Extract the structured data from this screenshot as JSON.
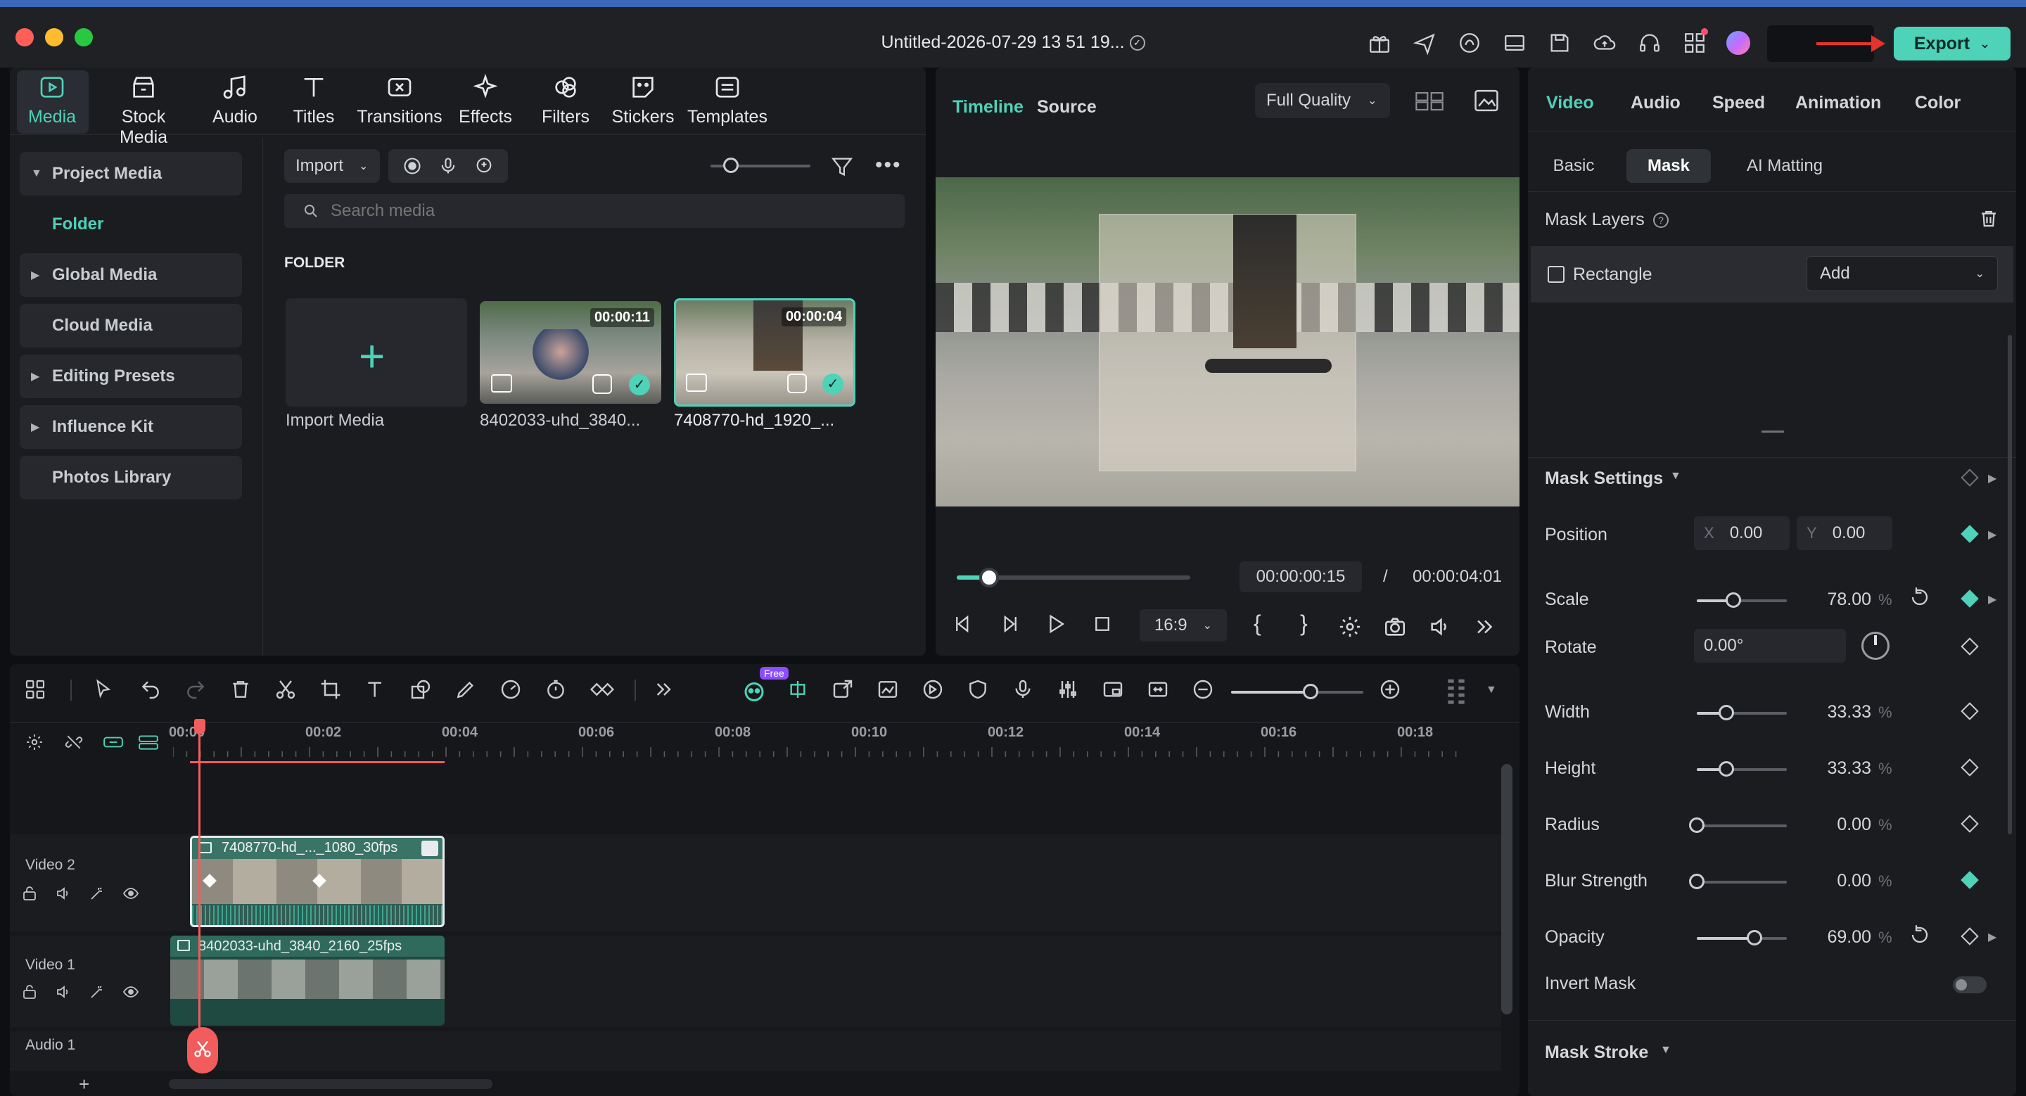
{
  "window": {
    "title": "Untitled-2026-07-29 13 51 19...",
    "export_label": "Export"
  },
  "colors": {
    "accent": "#4ed2b8",
    "playhead": "#f25c5c",
    "titlebar_stripe": "#3a69b9"
  },
  "toolbar": {
    "items": [
      {
        "label": "Media",
        "icon": "media-icon"
      },
      {
        "label": "Stock Media",
        "icon": "stock-media-icon"
      },
      {
        "label": "Audio",
        "icon": "music-note-icon"
      },
      {
        "label": "Titles",
        "icon": "text-t-icon"
      },
      {
        "label": "Transitions",
        "icon": "transitions-icon"
      },
      {
        "label": "Effects",
        "icon": "sparkle-icon"
      },
      {
        "label": "Filters",
        "icon": "filters-icon"
      },
      {
        "label": "Stickers",
        "icon": "sticker-icon"
      },
      {
        "label": "Templates",
        "icon": "templates-icon"
      }
    ]
  },
  "sidebar": {
    "items": [
      {
        "label": "Project Media",
        "expanded": true
      },
      {
        "label": "Folder",
        "active": true
      },
      {
        "label": "Global Media"
      },
      {
        "label": "Cloud Media"
      },
      {
        "label": "Editing Presets"
      },
      {
        "label": "Influence Kit"
      },
      {
        "label": "Photos Library"
      }
    ]
  },
  "media": {
    "import_label": "Import",
    "search_placeholder": "Search media",
    "folder_heading": "FOLDER",
    "import_media_label": "Import Media",
    "clips": [
      {
        "name": "8402033-uhd_3840...",
        "duration": "00:00:11"
      },
      {
        "name": "7408770-hd_1920_...",
        "duration": "00:00:04"
      }
    ]
  },
  "preview": {
    "tab_timeline": "Timeline",
    "tab_source": "Source",
    "quality": "Full Quality",
    "current_time": "00:00:00:15",
    "separator": "/",
    "total_time": "00:00:04:01",
    "aspect": "16:9",
    "progress": 0.14
  },
  "inspector": {
    "tabs": [
      "Video",
      "Audio",
      "Speed",
      "Animation",
      "Color"
    ],
    "subtabs": [
      "Basic",
      "Mask",
      "AI Matting"
    ],
    "mask_layers_label": "Mask Layers",
    "layer_name": "Rectangle",
    "add_label": "Add",
    "mask_settings_label": "Mask Settings",
    "position_label": "Position",
    "pos_x_label": "X",
    "pos_x": "0.00",
    "pos_y_label": "Y",
    "pos_y": "0.00",
    "rotate_label": "Rotate",
    "rotate_value": "0.00°",
    "pct_unit": "%",
    "props": [
      {
        "label": "Scale",
        "value": "78.00",
        "fraction": 0.41
      },
      {
        "label": "Width",
        "value": "33.33",
        "fraction": 0.33
      },
      {
        "label": "Height",
        "value": "33.33",
        "fraction": 0.33
      },
      {
        "label": "Radius",
        "value": "0.00",
        "fraction": 0.0
      },
      {
        "label": "Blur Strength",
        "value": "0.00",
        "fraction": 0.0
      },
      {
        "label": "Opacity",
        "value": "69.00",
        "fraction": 0.64
      }
    ],
    "invert_mask_label": "Invert Mask",
    "mask_stroke_label": "Mask Stroke"
  },
  "timeline": {
    "ruler": [
      "00:00",
      "00:02",
      "00:04",
      "00:06",
      "00:08",
      "00:10",
      "00:12",
      "00:14",
      "00:16",
      "00:18"
    ],
    "free_badge": "Free",
    "tracks": [
      {
        "label": "Video 2",
        "clip": "7408770-hd_..._1080_30fps"
      },
      {
        "label": "Video 1",
        "clip": "8402033-uhd_3840_2160_25fps"
      },
      {
        "label": "Audio 1"
      }
    ]
  }
}
